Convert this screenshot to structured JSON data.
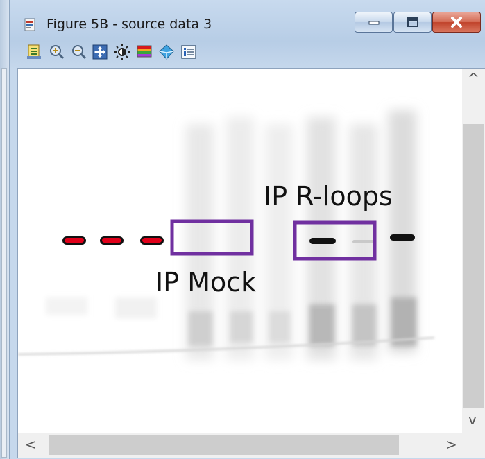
{
  "window": {
    "title": "Figure 5B - source data 3",
    "controls": {
      "minimize_icon": "minimize-icon",
      "maximize_icon": "maximize-icon",
      "close_icon": "close-icon"
    }
  },
  "toolbar": {
    "items": [
      "properties-icon",
      "zoom-in-icon",
      "zoom-out-icon",
      "fit-to-window-icon",
      "brightness-icon",
      "color-palette-icon",
      "3d-view-icon",
      "info-icon"
    ]
  },
  "image": {
    "annotations": {
      "mock_label": "IP Mock",
      "rloops_label": "IP R-loops"
    },
    "box_color": "#7030a0",
    "band_saturated_color": "#e0001a"
  },
  "scrollbars": {
    "up_arrow": "^",
    "down_arrow": "v",
    "left_arrow": "<",
    "right_arrow": ">"
  }
}
